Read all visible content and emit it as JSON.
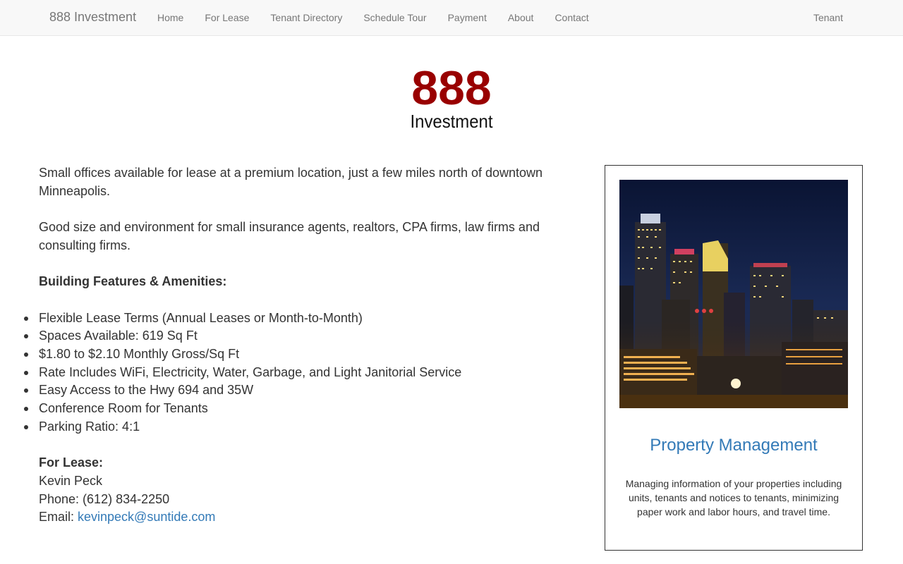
{
  "nav": {
    "brand": "888 Investment",
    "links": [
      "Home",
      "For Lease",
      "Tenant Directory",
      "Schedule Tour",
      "Payment",
      "About",
      "Contact"
    ],
    "right_link": "Tenant"
  },
  "logo": {
    "number": "888",
    "word": "Investment",
    "color": "#990000"
  },
  "intro": {
    "p1": "Small offices available for lease at a premium location, just a few miles north of downtown Minneapolis.",
    "p2": "Good size and environment for small insurance agents, realtors, CPA firms, law firms and consulting firms."
  },
  "features": {
    "title": "Building Features & Amenities:",
    "items": [
      "Flexible Lease Terms (Annual Leases or Month-to-Month)",
      "Spaces Available: 619 Sq Ft",
      "$1.80 to $2.10 Monthly Gross/Sq Ft",
      "Rate Includes WiFi, Electricity, Water, Garbage, and Light Janitorial Service",
      "Easy Access to the Hwy 694 and 35W",
      "Conference Room for Tenants",
      "Parking Ratio: 4:1"
    ]
  },
  "lease": {
    "title": "For Lease:",
    "name": "Kevin Peck",
    "phone": "Phone: (612) 834-2250",
    "email_label": "Email: ",
    "email": "kevinpeck@suntide.com"
  },
  "card": {
    "title": "Property Management",
    "description": "Managing information of your properties including units, tenants and notices to tenants, minimizing paper work and labor hours, and travel time.",
    "link_color": "#337ab7"
  }
}
